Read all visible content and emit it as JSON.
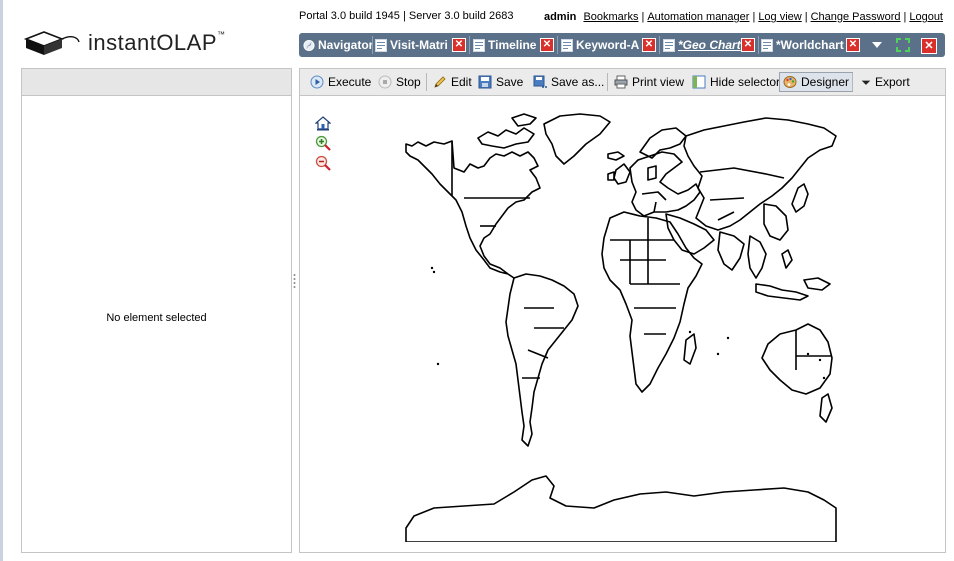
{
  "app": {
    "logo_text": "instantOLAP",
    "logo_tm": "™",
    "build_info": "Portal 3.0 build 1945 | Server 3.0 build 2683"
  },
  "header": {
    "user": "admin",
    "links": [
      "Bookmarks",
      "Automation manager",
      "Log view",
      "Change Password",
      "Logout"
    ],
    "separator": "|"
  },
  "tabs": [
    {
      "label": "Navigator",
      "icon": "compass-icon",
      "closable": false
    },
    {
      "label": "Visit-Matri",
      "icon": "report-icon",
      "closable": true
    },
    {
      "label": "Timeline",
      "icon": "report-icon",
      "closable": true
    },
    {
      "label": "Keyword-A",
      "icon": "report-icon",
      "closable": true
    },
    {
      "label": "*Geo Chart",
      "icon": "report-icon",
      "closable": true,
      "active": true
    },
    {
      "label": "*Worldchart",
      "icon": "report-icon",
      "closable": true
    }
  ],
  "tab_close_glyph": "✕",
  "left_panel": {
    "message": "No element selected"
  },
  "toolbar": {
    "execute": "Execute",
    "stop": "Stop",
    "edit": "Edit",
    "save": "Save",
    "save_as": "Save as...",
    "print_view": "Print view",
    "hide_selector": "Hide selector",
    "designer": "Designer",
    "export": "Export"
  },
  "map_tools": [
    "home-icon",
    "zoom-in-icon",
    "zoom-out-icon"
  ],
  "colors": {
    "tabbar": "#5b7189",
    "close_red": "#d9302c",
    "toolbar_bg": "#ebebeb",
    "panel_header": "#e6e6e6"
  }
}
